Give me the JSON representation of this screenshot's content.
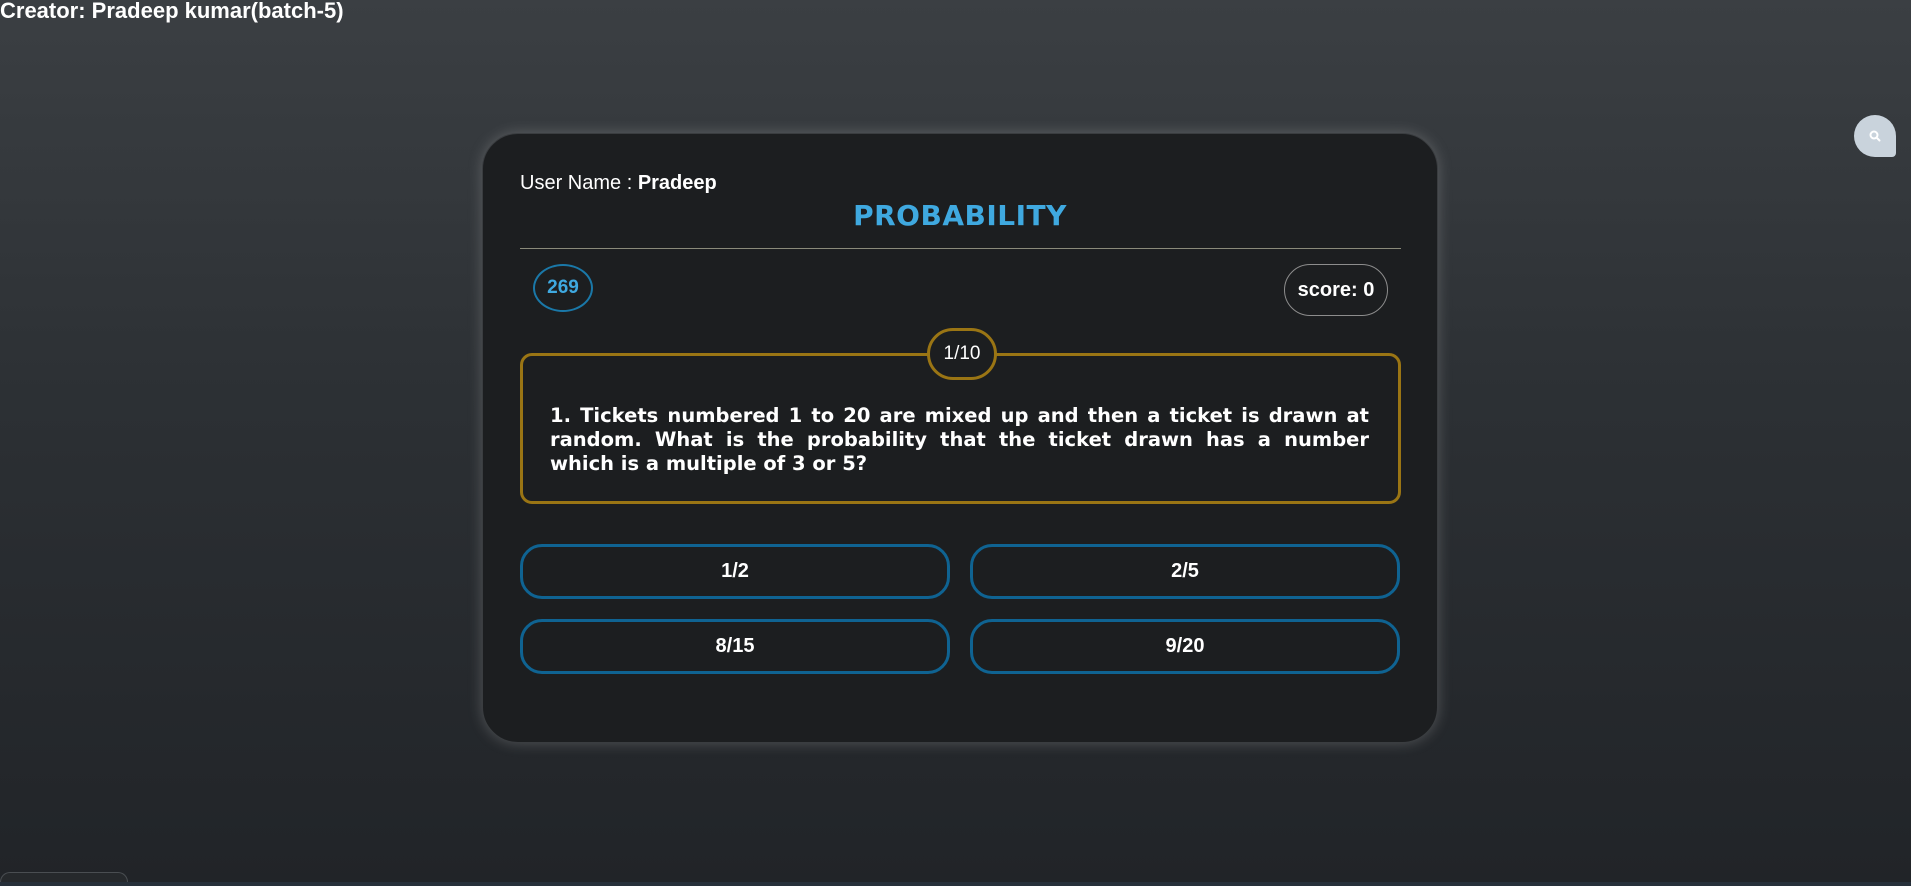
{
  "header": {
    "creator": "Creator: Pradeep kumar(batch-5)"
  },
  "floating_button": {
    "icon": "search-icon"
  },
  "quiz": {
    "username_label": "User Name : ",
    "username": "Pradeep",
    "title": "PROBABILITY",
    "timer": "269",
    "score": "score: 0",
    "counter": "1/10",
    "question": "1. Tickets numbered 1 to 20 are mixed up and then a ticket is drawn at random. What is the probability that the ticket drawn has a number which is a multiple of 3 or 5?",
    "options": [
      "1/2",
      "2/5",
      "8/15",
      "9/20"
    ]
  },
  "colors": {
    "accent": "#3fa9e0",
    "option_border": "#0f6392",
    "question_border": "#9a7514",
    "card_bg": "#1c1e20"
  }
}
